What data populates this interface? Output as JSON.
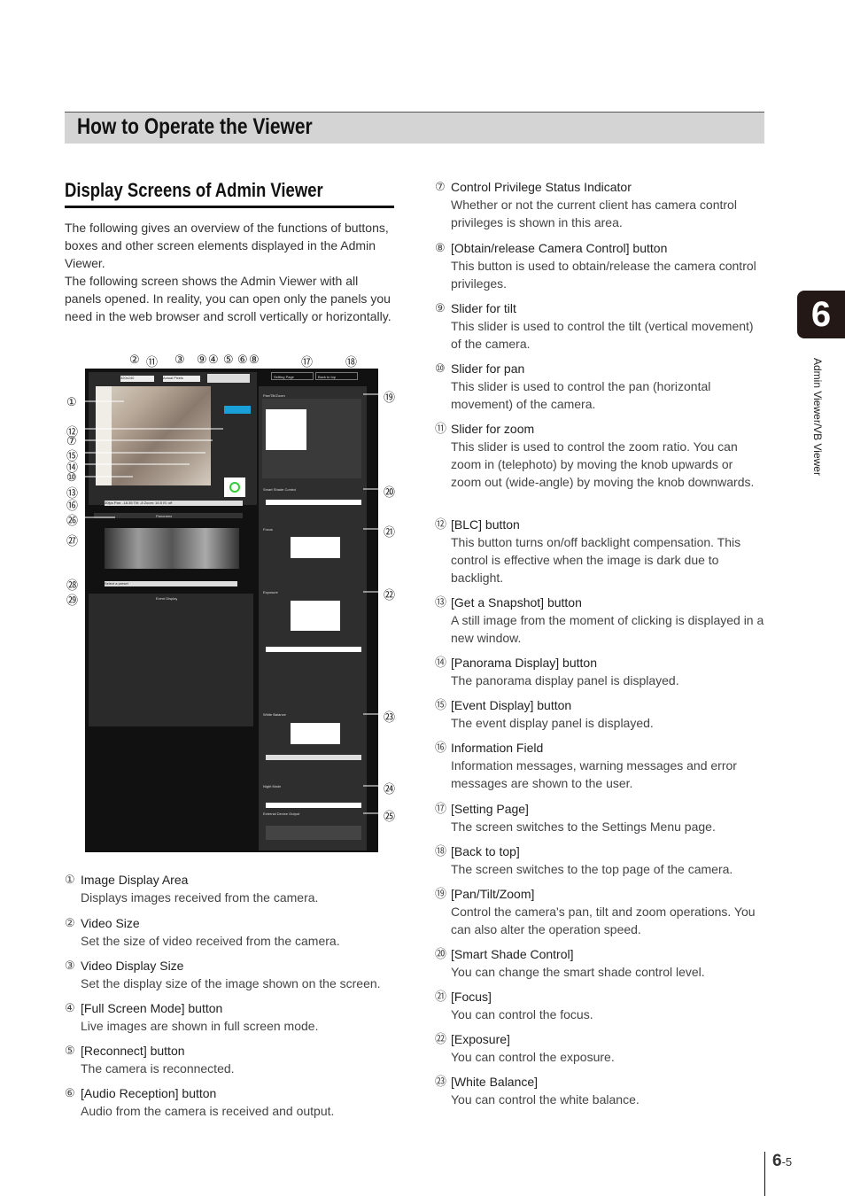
{
  "header": {
    "title": "How to Operate the Viewer"
  },
  "section": {
    "title": "Display Screens of Admin Viewer"
  },
  "intro": "The following gives an overview of the functions of buttons, boxes and other screen elements displayed in the Admin Viewer.\nThe following screen shows the Admin Viewer with all panels opened. In reality, you can open only the panels you need in the web browser and scroll vertically or horizontally.",
  "chapter_tab": {
    "number": "6",
    "label": "Admin Viewer/VB Viewer"
  },
  "page_number": {
    "chapter": "6",
    "page": "-5"
  },
  "figure": {
    "top_buttons": [
      "Setting Page",
      "Back to top"
    ],
    "video_size": "320x240",
    "display_size": "Actual Pixels",
    "info": "30fps Pan: -18.35 Tilt: -8 Zoom: 16.5 IS: off",
    "panels": [
      "Pan/Tilt/Zoom",
      "Smart Shade Control",
      "Focus",
      "Exposure",
      "White Balance",
      "Night Mode",
      "External Device Output",
      "Panorama",
      "Event Display"
    ],
    "speed": [
      "Fast",
      "Normal",
      "Slow"
    ],
    "shade": [
      "On",
      "Off"
    ],
    "modes": [
      "Day Mode",
      "Night Mode"
    ],
    "preset": "Select a preset",
    "callouts_top": [
      "②",
      "⑪",
      "③",
      "⑨",
      "④",
      "⑤",
      "⑥",
      "⑧",
      "⑰",
      "⑱"
    ],
    "callouts_left": [
      "①",
      "⑫",
      "⑦",
      "⑮",
      "⑭",
      "⑩",
      "⑬",
      "⑯",
      "㉖",
      "㉗",
      "㉘",
      "㉙"
    ],
    "callouts_right": [
      "⑲",
      "⑳",
      "㉑",
      "㉒",
      "㉓",
      "㉔",
      "㉕"
    ]
  },
  "left_items": [
    {
      "num": "①",
      "title": "Image Display Area",
      "desc": "Displays images received from the camera."
    },
    {
      "num": "②",
      "title": "Video Size",
      "desc": "Set the size of video received from the camera."
    },
    {
      "num": "③",
      "title": "Video Display Size",
      "desc": "Set the display size of the image shown on the screen."
    },
    {
      "num": "④",
      "title": "[Full Screen Mode] button",
      "desc": "Live images are shown in full screen mode."
    },
    {
      "num": "⑤",
      "title": "[Reconnect] button",
      "desc": "The camera is reconnected."
    },
    {
      "num": "⑥",
      "title": "[Audio Reception] button",
      "desc": "Audio from the camera is received and output."
    }
  ],
  "right_items": [
    {
      "num": "⑦",
      "title": "Control Privilege Status Indicator",
      "desc": "Whether or not the current client has camera control privileges is shown in this area."
    },
    {
      "num": "⑧",
      "title": "[Obtain/release Camera Control] button",
      "desc": "This button is used to obtain/release the camera control privileges."
    },
    {
      "num": "⑨",
      "title": "Slider for tilt",
      "desc": "This slider is used to control the tilt (vertical movement) of the camera."
    },
    {
      "num": "⑩",
      "title": "Slider for pan",
      "desc": "This slider is used to control the pan (horizontal movement) of the camera."
    },
    {
      "num": "⑪",
      "title": "Slider for zoom",
      "desc": "This slider is used to control the zoom ratio. You can zoom in (telephoto) by moving the knob upwards or zoom out (wide-angle) by moving the knob downwards."
    },
    {
      "num": "⑫",
      "title": "[BLC] button",
      "desc": "This button turns on/off backlight compensation. This control is effective when the image is dark due to backlight."
    },
    {
      "num": "⑬",
      "title": "[Get a Snapshot] button",
      "desc": "A still image from the moment of clicking is displayed in a new window."
    },
    {
      "num": "⑭",
      "title": "[Panorama Display] button",
      "desc": "The panorama display panel is displayed."
    },
    {
      "num": "⑮",
      "title": "[Event Display] button",
      "desc": "The event display panel is displayed."
    },
    {
      "num": "⑯",
      "title": "Information Field",
      "desc": "Information messages, warning messages and error messages are shown to the user."
    },
    {
      "num": "⑰",
      "title": "[Setting Page]",
      "desc": "The screen switches to the Settings Menu page."
    },
    {
      "num": "⑱",
      "title": "[Back to top]",
      "desc": "The screen switches to the top page of the camera."
    },
    {
      "num": "⑲",
      "title": "[Pan/Tilt/Zoom]",
      "desc": "Control the camera's pan, tilt and zoom operations. You can also alter the operation speed."
    },
    {
      "num": "⑳",
      "title": "[Smart Shade Control]",
      "desc": "You can change the smart shade control level."
    },
    {
      "num": "㉑",
      "title": "[Focus]",
      "desc": "You can control the focus."
    },
    {
      "num": "㉒",
      "title": "[Exposure]",
      "desc": "You can control the exposure."
    },
    {
      "num": "㉓",
      "title": "[White Balance]",
      "desc": "You can control the white balance."
    }
  ]
}
